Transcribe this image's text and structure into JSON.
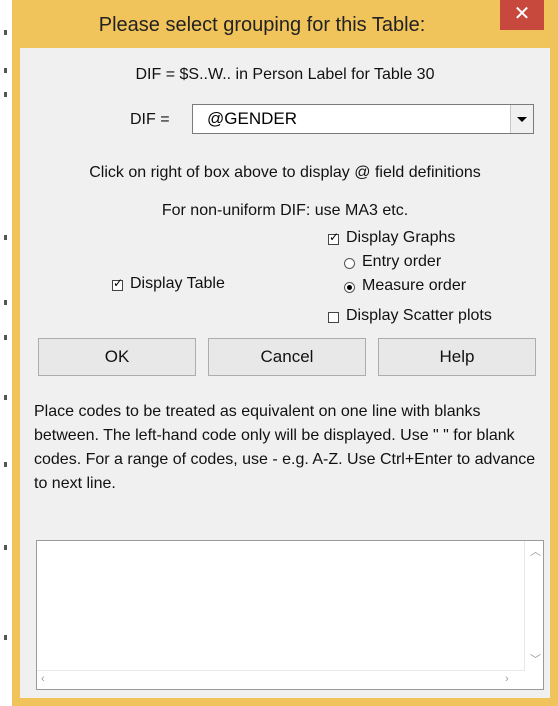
{
  "window": {
    "title": "Please select grouping for this Table:",
    "close_label": "✕"
  },
  "header": {
    "dif_description": "DIF = $S..W.. in Person Label for Table 30"
  },
  "dif_field": {
    "label": "DIF =",
    "value": "@GENDER"
  },
  "hints": {
    "click_hint": "Click on right of box above to display @ field definitions",
    "nonuniform_hint": "For non-uniform DIF: use MA3 etc."
  },
  "options": {
    "display_graphs": {
      "label": "Display Graphs",
      "checked": true
    },
    "display_table": {
      "label": "Display Table",
      "checked": true
    },
    "entry_order": {
      "label": "Entry order",
      "selected": false
    },
    "measure_order": {
      "label": "Measure order",
      "selected": true
    },
    "display_scatter": {
      "label": "Display Scatter plots",
      "checked": false
    }
  },
  "buttons": {
    "ok": "OK",
    "cancel": "Cancel",
    "help": "Help"
  },
  "instructions": "Place codes to be treated as equivalent on one line with blanks between. The left-hand code only will be displayed. Use \" \" for blank codes. For a range of codes, use - e.g. A-Z. Use Ctrl+Enter to advance to next line.",
  "codes_text": {
    "value": ""
  },
  "colors": {
    "title_bar": "#f0c45a",
    "close_button": "#c7483c",
    "client_bg": "#f0f0f0"
  }
}
